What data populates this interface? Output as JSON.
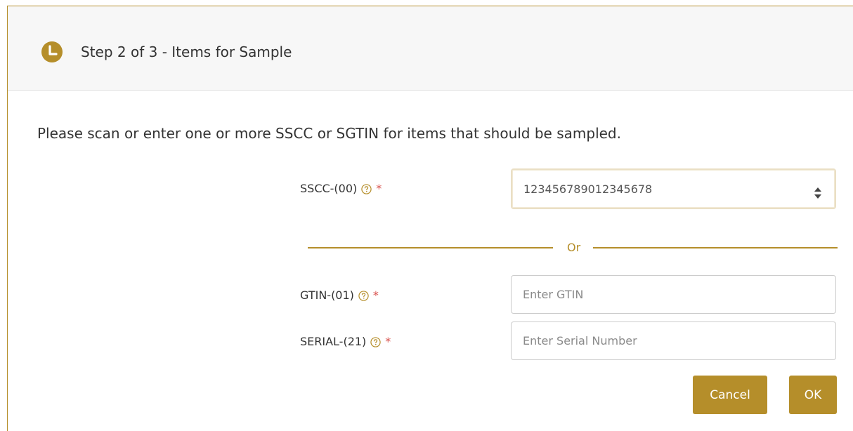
{
  "header": {
    "title": "Step 2 of 3 - Items for Sample",
    "icon": "clock-icon"
  },
  "instructions": "Please scan or enter one or more SSCC or SGTIN for items that should be sampled.",
  "form": {
    "sscc": {
      "label": "SSCC-(00)",
      "required_mark": "*",
      "value": "123456789012345678"
    },
    "divider_text": "Or",
    "gtin": {
      "label": "GTIN-(01)",
      "required_mark": "*",
      "placeholder": "Enter GTIN"
    },
    "serial": {
      "label": "SERIAL-(21)",
      "required_mark": "*",
      "placeholder": "Enter Serial Number"
    }
  },
  "buttons": {
    "cancel": "Cancel",
    "ok": "OK"
  },
  "colors": {
    "accent": "#b58e2a",
    "required": "#d9534f",
    "header_bg": "#f7f7f7"
  }
}
